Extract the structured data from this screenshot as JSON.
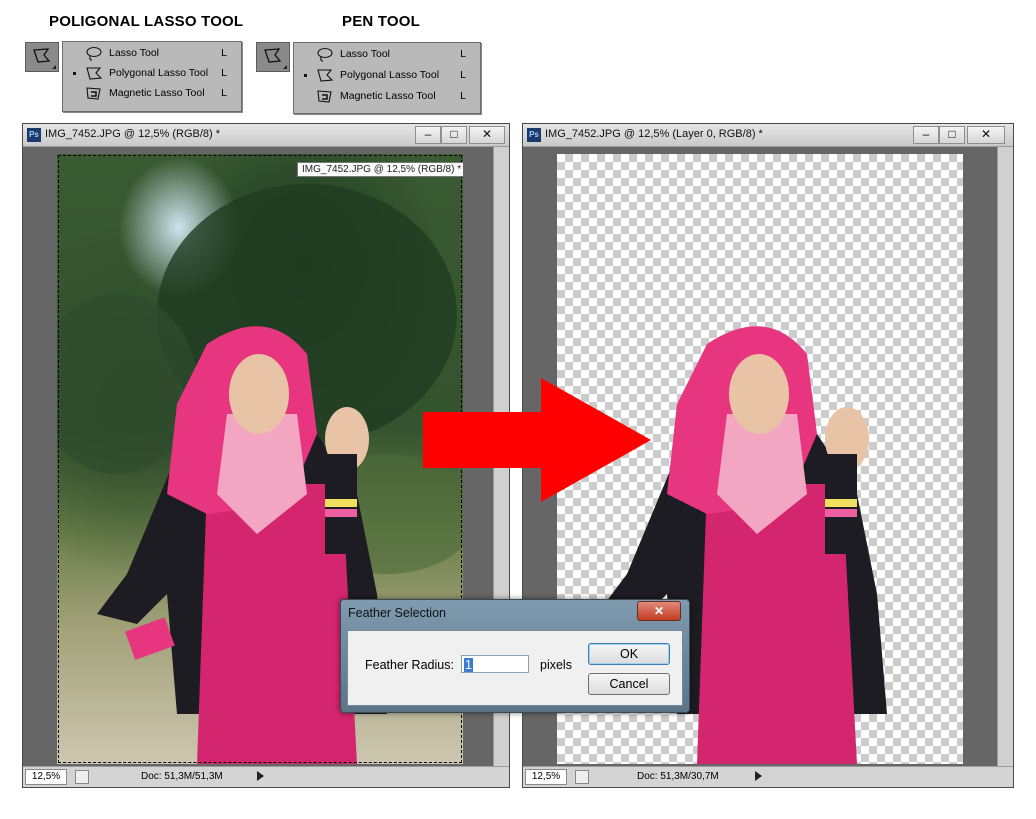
{
  "headings": {
    "left": "POLIGONAL LASSO TOOL",
    "right": "PEN TOOL"
  },
  "flyout_left": {
    "items": [
      {
        "label": "Lasso Tool",
        "key": "L"
      },
      {
        "label": "Polygonal Lasso Tool",
        "key": "L"
      },
      {
        "label": "Magnetic Lasso Tool",
        "key": "L"
      }
    ]
  },
  "flyout_right": {
    "items": [
      {
        "label": "Lasso Tool",
        "key": "L"
      },
      {
        "label": "Polygonal Lasso Tool",
        "key": "L"
      },
      {
        "label": "Magnetic Lasso Tool",
        "key": "L"
      }
    ]
  },
  "left_window": {
    "title": "IMG_7452.JPG @ 12,5% (RGB/8) *",
    "tooltip": "IMG_7452.JPG @ 12,5% (RGB/8) *",
    "zoom": "12,5%",
    "doc": "Doc: 51,3M/51,3M",
    "buttons": {
      "minimize": "–",
      "maximize": "□",
      "close": "✕"
    }
  },
  "right_window": {
    "title": "IMG_7452.JPG @ 12,5% (Layer 0, RGB/8) *",
    "zoom": "12,5%",
    "doc": "Doc: 51,3M/30,7M",
    "buttons": {
      "minimize": "–",
      "maximize": "□",
      "close": "✕"
    }
  },
  "dialog": {
    "title": "Feather Selection",
    "close": "✕",
    "label": "Feather Radius:",
    "value": "1",
    "unit": "pixels",
    "ok": "OK",
    "cancel": "Cancel"
  },
  "colors": {
    "arrow": "#ff0000",
    "hijab": "#e8357f",
    "dress": "#d4256f",
    "jacket": "#1c1c22",
    "skin": "#e8c3a6"
  },
  "icons": {
    "tool": "polygonal-lasso-icon",
    "arrow": "red-right-arrow"
  }
}
